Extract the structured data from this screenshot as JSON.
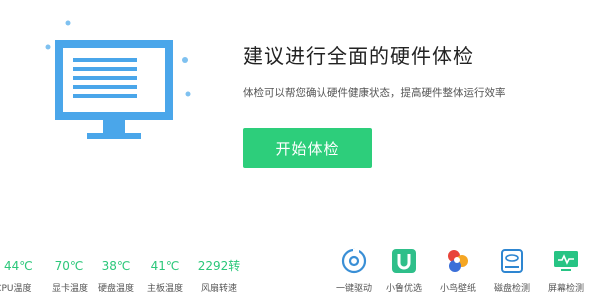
{
  "hero": {
    "title": "建议进行全面的硬件体检",
    "subtitle": "体检可以帮您确认硬件健康状态，提高硬件整体运行效率",
    "start_button": "开始体检"
  },
  "stats": [
    {
      "value": "44℃",
      "label": "CPU温度"
    },
    {
      "value": "70℃",
      "label": "显卡温度"
    },
    {
      "value": "38℃",
      "label": "硬盘温度"
    },
    {
      "value": "41℃",
      "label": "主板温度"
    },
    {
      "value": "2292转",
      "label": "风扇转速"
    }
  ],
  "tools": [
    {
      "label": "一键驱动",
      "icon": "driver-icon"
    },
    {
      "label": "小鲁优选",
      "icon": "u-shop-icon"
    },
    {
      "label": "小鸟壁纸",
      "icon": "wallpaper-icon"
    },
    {
      "label": "磁盘检测",
      "icon": "disk-icon"
    },
    {
      "label": "屏幕检测",
      "icon": "screen-icon"
    }
  ],
  "colors": {
    "accent_green": "#2dce7b",
    "stat_green": "#2bc77a",
    "monitor_blue": "#4aa6ea",
    "dot_blue": "#7fc1f0"
  }
}
